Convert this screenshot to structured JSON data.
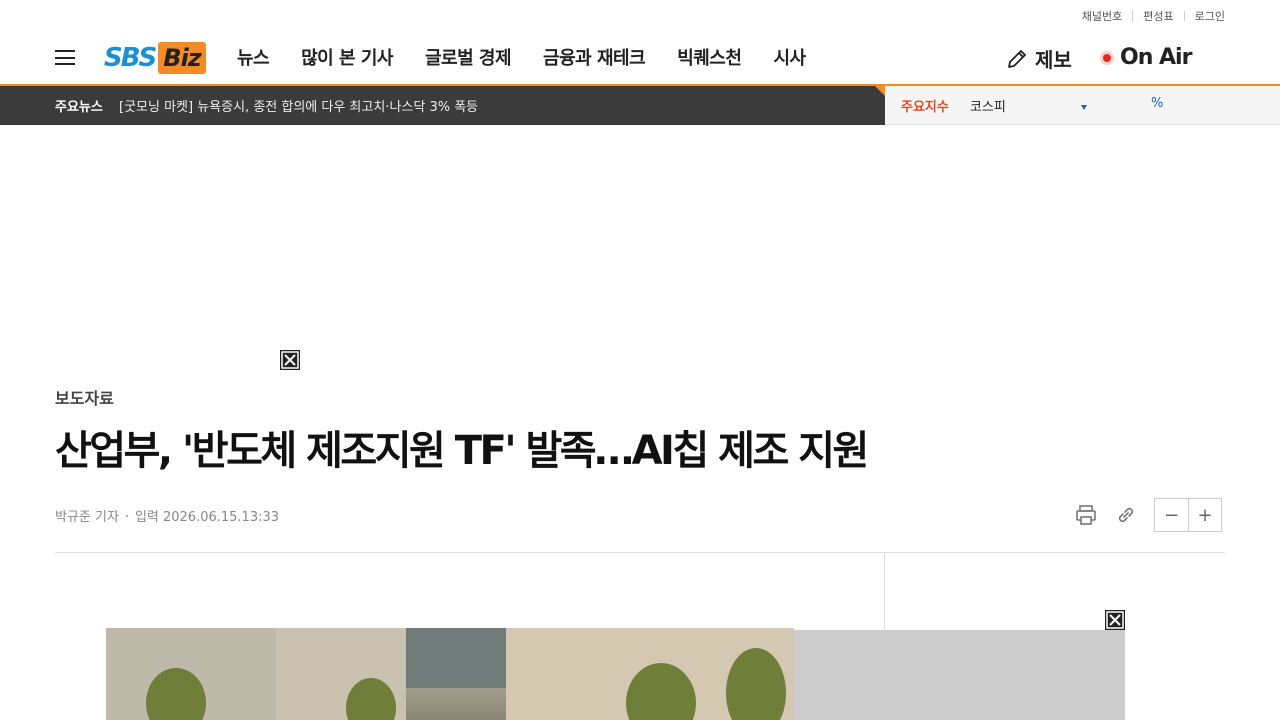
{
  "util_links": [
    "채널번호",
    "편성표",
    "로그인"
  ],
  "logo": {
    "sbs": "SBS",
    "biz": "Biz"
  },
  "nav": [
    "뉴스",
    "많이 본 기사",
    "글로벌 경제",
    "금융과 재테크",
    "빅퀘스천",
    "시사"
  ],
  "header_right": {
    "jebo": "제보",
    "onair": "On Air"
  },
  "ticker": {
    "tag": "주요뉴스",
    "headline": "[굿모닝 마켓] 뉴욕증시, 종전 합의에 다우 최고치·나스닥 3% 폭등"
  },
  "index": {
    "label": "주요지수",
    "name": "코스피",
    "pct": "%"
  },
  "article": {
    "category": "보도자료",
    "title": "산업부, '반도체 제조지원 TF' 발족…AI칩 제조 지원",
    "reporter": "박규준 기자",
    "date": "입력 2026.06.15.13:33"
  },
  "tools": {
    "print": "print-icon",
    "link": "link-icon",
    "minus": "−",
    "plus": "+"
  },
  "colors": {
    "brand_blue": "#1a8fd1",
    "brand_orange": "#f28c28",
    "ticker_bg": "#3b3b3b",
    "index_red": "#e8481e",
    "index_blue": "#1a5fc8"
  }
}
